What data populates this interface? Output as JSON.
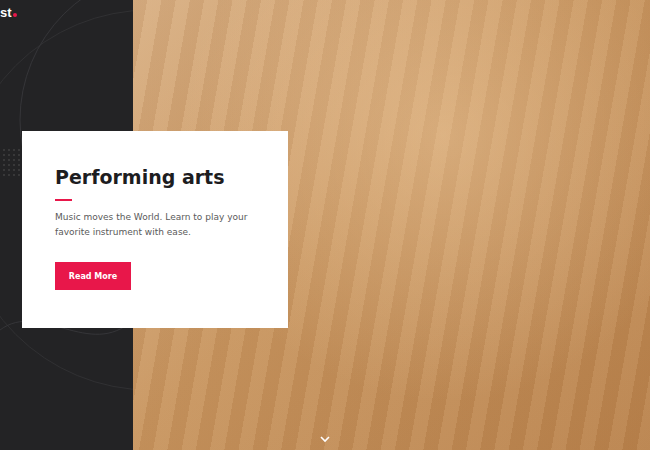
{
  "logo": {
    "text": "st"
  },
  "hero": {
    "title": "Performing arts",
    "description": "Music moves the World. Learn to play your favorite instrument with ease.",
    "button": "Read More"
  }
}
